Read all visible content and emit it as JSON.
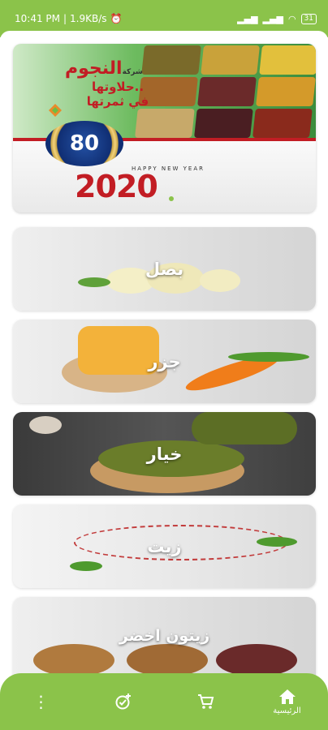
{
  "status_bar": {
    "time": "10:41 PM",
    "speed": "1.9KB/s",
    "battery": "31"
  },
  "banner": {
    "brand": "النجوم",
    "brand_prefix": "شركة",
    "tagline_line1": "حلاوتها..",
    "tagline_line2": "في ثمرتها",
    "badge_number": "80",
    "new_year": "HAPPY NEW YEAR",
    "year": "2020"
  },
  "categories": [
    {
      "label": "بصل"
    },
    {
      "label": "جزر"
    },
    {
      "label": "خيار"
    },
    {
      "label": "زيت"
    },
    {
      "label": "زيتون اخضر"
    }
  ],
  "bottom_nav": {
    "home_label": "الرئيسية",
    "icons": [
      "home-icon",
      "cart-icon",
      "add-check-icon",
      "more-vertical-icon"
    ]
  },
  "colors": {
    "primary": "#8bc34a",
    "brand_red": "#c21d24"
  }
}
